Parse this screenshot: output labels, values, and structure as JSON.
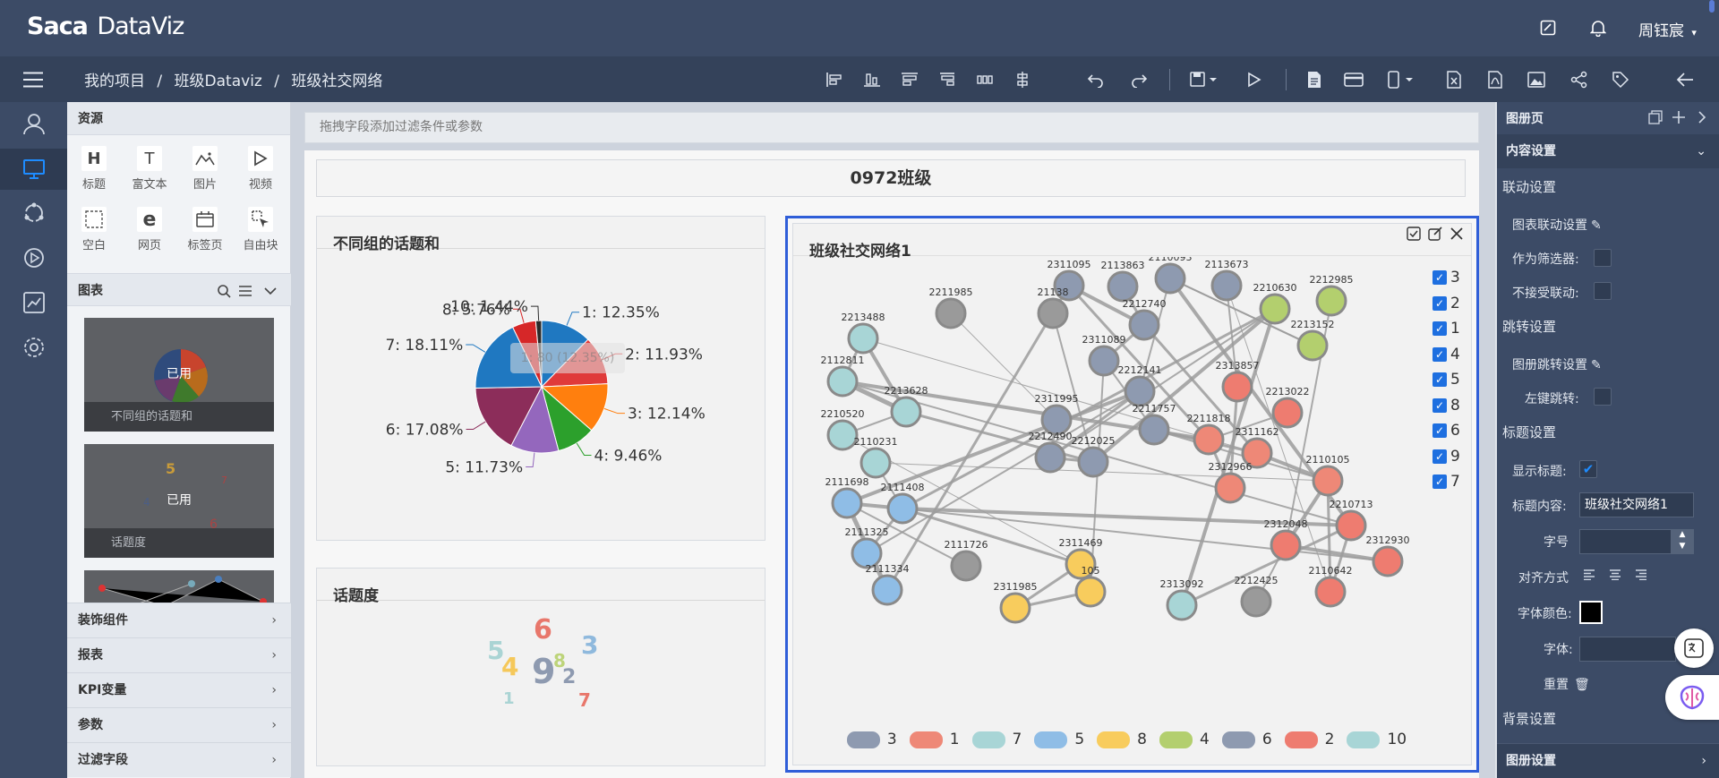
{
  "app": {
    "logo_mark": "Sa",
    "logo_mark2": "ca",
    "logo_text": "DataViz",
    "user": "周钰宸"
  },
  "breadcrumb": {
    "items": [
      "我的项目",
      "班级Dataviz",
      "班级社交网络"
    ],
    "sep": "/"
  },
  "resources": {
    "title": "资源",
    "tools": [
      {
        "icon_char": "H",
        "label": "标题"
      },
      {
        "icon_char": "T",
        "label": "富文本"
      },
      {
        "icon_char": "⌇",
        "label": "图片"
      },
      {
        "icon_char": "▷",
        "label": "视频"
      },
      {
        "icon_char": "⬚",
        "label": "空白"
      },
      {
        "icon_char": "e",
        "label": "网页"
      },
      {
        "icon_char": "▭",
        "label": "标签页"
      },
      {
        "icon_char": "✚",
        "label": "自由块"
      }
    ],
    "charts_title": "图表",
    "chart_thumbs": [
      {
        "badge": "已用",
        "caption": "不同组的话题和"
      },
      {
        "badge": "已用",
        "caption": "话题度"
      }
    ],
    "accordions": [
      "装饰组件",
      "报表",
      "KPI变量",
      "参数",
      "过滤字段"
    ]
  },
  "canvas": {
    "filter_placeholder": "拖拽字段添加过滤条件或参数",
    "page_title": "0972班级",
    "pie_panel": {
      "title": "不同组的话题和",
      "tooltip": "1: 80 (12.35%)"
    },
    "cloud_panel": {
      "title": "话题度"
    },
    "network_panel": {
      "title": "班级社交网络1"
    }
  },
  "right_panel": {
    "section_title": "图册页",
    "content_settings": "内容设置",
    "linkage_settings": "联动设置",
    "chart_linkage": "图表联动设置",
    "as_filter": "作为筛选器:",
    "no_linkage": "不接受联动:",
    "jump_settings": "跳转设置",
    "album_jump": "图册跳转设置",
    "left_click_jump": "左键跳转:",
    "title_settings": "标题设置",
    "show_title": "显示标题:",
    "title_content_label": "标题内容:",
    "title_content_value": "班级社交网络1",
    "font_size_label": "字号",
    "align_label": "对齐方式",
    "font_color_label": "字体颜色:",
    "font_label": "字体:",
    "reset_label": "重置",
    "bg_settings": "背景设置",
    "album_settings": "图册设置"
  },
  "colors": {
    "accent": "#1e6fe0",
    "header": "#3c4b66",
    "selection": "#2f5ed8"
  },
  "chart_data": [
    {
      "type": "pie",
      "title": "不同组的话题和",
      "slices": [
        {
          "label": "1: 12.35%",
          "value": 12.35,
          "color": "#1f78c1"
        },
        {
          "label": "2: 11.93%",
          "value": 11.93,
          "color": "#e03a3a"
        },
        {
          "label": "3: 12.14%",
          "value": 12.14,
          "color": "#ff7f0e"
        },
        {
          "label": "4: 9.46%",
          "value": 9.46,
          "color": "#2ca02c"
        },
        {
          "label": "5: 11.73%",
          "value": 11.73,
          "color": "#9467bd"
        },
        {
          "label": "6: 17.08%",
          "value": 17.08,
          "color": "#8c2d5a"
        },
        {
          "label": "7: 18.11%",
          "value": 18.11,
          "color": "#1f78c1"
        },
        {
          "label": "8: 5.76%",
          "value": 5.76,
          "color": "#d62728"
        },
        {
          "label": "10: 1.44%",
          "value": 1.44,
          "color": "#2b2b2b"
        }
      ]
    },
    {
      "type": "wordcloud",
      "title": "话题度",
      "words": [
        {
          "text": "6",
          "color": "#e8776b",
          "size": 30
        },
        {
          "text": "3",
          "color": "#8fb9dd",
          "size": 28
        },
        {
          "text": "5",
          "color": "#aad4d4",
          "size": 28
        },
        {
          "text": "8",
          "color": "#bdd47a",
          "size": 20
        },
        {
          "text": "4",
          "color": "#f5c85a",
          "size": 28
        },
        {
          "text": "9",
          "color": "#8e9ab0",
          "size": 38
        },
        {
          "text": "2",
          "color": "#8e9ab0",
          "size": 22
        },
        {
          "text": "1",
          "color": "#aad4d4",
          "size": 18
        },
        {
          "text": "7",
          "color": "#e8776b",
          "size": 20
        }
      ]
    },
    {
      "type": "network",
      "title": "班级社交网络1",
      "groups": [
        {
          "name": "3",
          "color": "#8e9ab0"
        },
        {
          "name": "1",
          "color": "#ee8877"
        },
        {
          "name": "7",
          "color": "#a8d5d6"
        },
        {
          "name": "5",
          "color": "#8fbde6"
        },
        {
          "name": "8",
          "color": "#f8cc5d"
        },
        {
          "name": "4",
          "color": "#b3cf6e"
        },
        {
          "name": "6",
          "color": "#8e9ab0"
        },
        {
          "name": "2",
          "color": "#ee7c70"
        },
        {
          "name": "10",
          "color": "#a8d5d6"
        }
      ],
      "filter_groups": [
        "3",
        "2",
        "1",
        "4",
        "5",
        "8",
        "6",
        "9",
        "7"
      ],
      "nodes": [
        {
          "id": "2311095",
          "g": "3"
        },
        {
          "id": "2113863",
          "g": "3"
        },
        {
          "id": "2110093",
          "g": "3"
        },
        {
          "id": "2113673",
          "g": "3"
        },
        {
          "id": "2210630",
          "g": "4"
        },
        {
          "id": "2212985",
          "g": "4"
        },
        {
          "id": "2211985",
          "g": "9"
        },
        {
          "id": "21138",
          "g": "9"
        },
        {
          "id": "2212740",
          "g": "6"
        },
        {
          "id": "2213488",
          "g": "7"
        },
        {
          "id": "2213152",
          "g": "4"
        },
        {
          "id": "2311089",
          "g": "6"
        },
        {
          "id": "2112811",
          "g": "7"
        },
        {
          "id": "2313857",
          "g": "2"
        },
        {
          "id": "2212141",
          "g": "6"
        },
        {
          "id": "2213628",
          "g": "7"
        },
        {
          "id": "2311995",
          "g": "3"
        },
        {
          "id": "2213022",
          "g": "2"
        },
        {
          "id": "2210520",
          "g": "7"
        },
        {
          "id": "2211757",
          "g": "6"
        },
        {
          "id": "2211818",
          "g": "1"
        },
        {
          "id": "2311162",
          "g": "1"
        },
        {
          "id": "2212490",
          "g": "3"
        },
        {
          "id": "2212025",
          "g": "6"
        },
        {
          "id": "2110231",
          "g": "10"
        },
        {
          "id": "2312966",
          "g": "1"
        },
        {
          "id": "2110105",
          "g": "1"
        },
        {
          "id": "2111698",
          "g": "5"
        },
        {
          "id": "2111408",
          "g": "5"
        },
        {
          "id": "2210713",
          "g": "2"
        },
        {
          "id": "2312048",
          "g": "2"
        },
        {
          "id": "2111325",
          "g": "5"
        },
        {
          "id": "2111726",
          "g": "9"
        },
        {
          "id": "2311469",
          "g": "8"
        },
        {
          "id": "2312930",
          "g": "2"
        },
        {
          "id": "2111334",
          "g": "5"
        },
        {
          "id": "2311985",
          "g": "8"
        },
        {
          "id": "105",
          "g": "8"
        },
        {
          "id": "2313092",
          "g": "7"
        },
        {
          "id": "2212425",
          "g": "9"
        },
        {
          "id": "2110642",
          "g": "2"
        }
      ]
    }
  ]
}
